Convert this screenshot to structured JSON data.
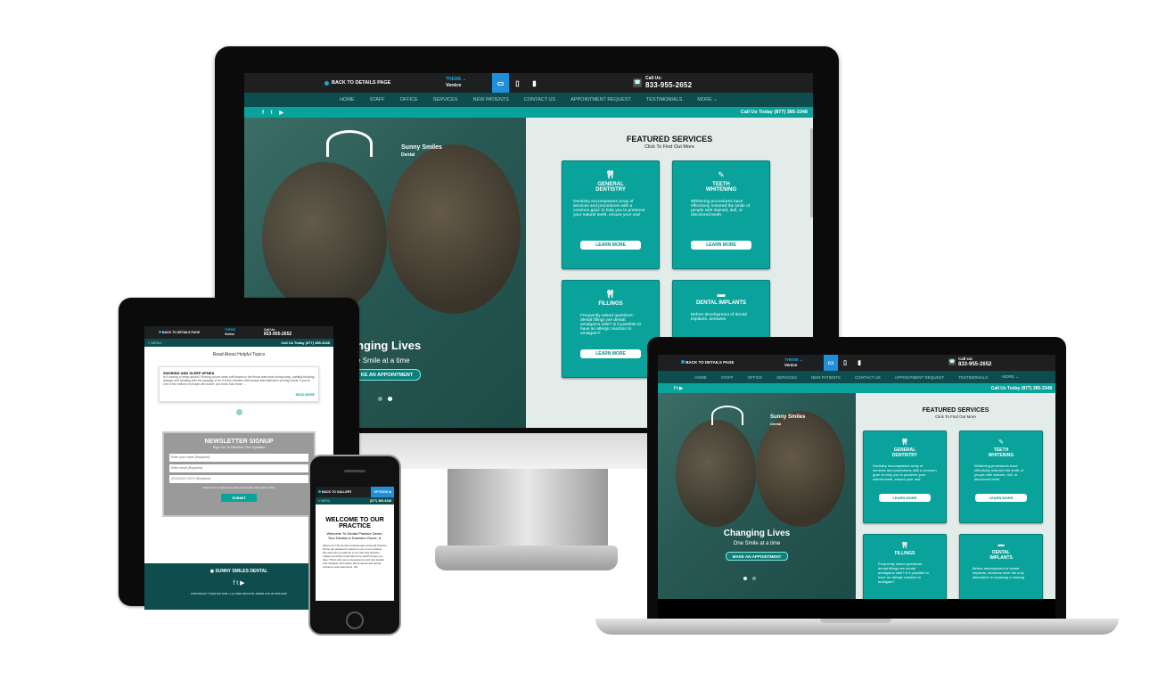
{
  "topbar": {
    "back_label": "BACK TO DETAILS PAGE",
    "theme_label": "THEME",
    "theme_value": "Venice",
    "call_label": "Call Us:",
    "call_number": "833-955-2652"
  },
  "nav": {
    "items": [
      "HOME",
      "STAFF",
      "OFFICE",
      "SERVICES",
      "NEW PATIENTS",
      "CONTACT US",
      "APPOINTMENT REQUEST",
      "TESTIMONIALS",
      "MORE"
    ]
  },
  "social": {
    "icons": "f  t  ▶",
    "call_today": "Call Us Today (877) 385-3348"
  },
  "hero": {
    "brand": "Sunny Smiles",
    "brand_sub": "Dental",
    "title_desktop": "nging Lives",
    "subtitle_desktop": "e Smile at a time",
    "title": "Changing Lives",
    "subtitle": "One Smile at a time",
    "cta": "MAKE AN APPOINTMENT",
    "cta_desktop": "KE AN APPOINTMENT"
  },
  "services": {
    "heading": "FEATURED SERVICES",
    "subheading": "Click To Find Out More",
    "cards": [
      {
        "title": "GENERAL DENTISTRY",
        "desc": "Dentistry encompasses array of services and procedures with a common goal: to help you to preserve your natural teeth, ensure your oral",
        "button": "LEARN MORE"
      },
      {
        "title": "TEETH WHITENING",
        "desc": "Whitening procedures have effectively restored the smile of people with stained, dull, or discolored teeth.",
        "button": "LEARN MORE"
      },
      {
        "title": "FILLINGS",
        "desc": "Frequently asked questions: dental fillings are dental amalgams safe? is it possible to have an allergic reaction to amalgam?",
        "button": "LEARN MORE"
      },
      {
        "title": "DENTAL IMPLANTS",
        "desc": "Before development of dental implants, dentures",
        "desc_laptop": "Before development of dental implants, dentures were the only alternative to replacing a missing",
        "button": "LEARN MORE"
      }
    ]
  },
  "tablet": {
    "menu": "≡ MENU",
    "call": "Call Us Today (877) 385-3348",
    "heading": "Read About Helpful Topics",
    "post_title": "SNORING AND SLEEP APNEA",
    "post_text": "Is it snoring or sleep apnea? Snoring occurs when soft tissues in the throat area relax during sleep, partially blocking airways and vibrating with the passage of air. It's this vibration that causes that distinctive snoring sound. If you're one of the millions of people who snore, you know how those ...",
    "read_more": "READ MORE",
    "newsletter_title": "NEWSLETTER SIGNUP",
    "newsletter_sub": "Sign Up To Receive Our Updates",
    "name_placeholder": "Enter your name (Required)",
    "email_placeholder": "Enter email (Required)",
    "phone_placeholder": "(XXX)XXX-XXXX (Required)",
    "disclaimer": "Please do not submit any Protected Health Information (PHI).",
    "submit": "SUBMIT",
    "footer_brand": "SUNNY SMILES DENTAL",
    "footer_icons": "f  t  ▶",
    "copyright": "COPYRIGHT © 2020 MH SUB I, LLC DBA OFFICITE.   ADMIN LOG IN     SITE MAP"
  },
  "phone": {
    "back": "BACK TO GALLERY",
    "options": "OPTIONS",
    "menu": "≡ MENU",
    "call": "(877) 385-3348",
    "welcome_title": "WELCOME TO OUR PRACTICE",
    "welcome_sub": "Welcome To Dental Practice Demo, Your Dentist in Downers Grove, IL",
    "body": "Welcome! This dental professionals at Dental Practice Demo are pleased to welcome you to our practice. We want all our patients to be informed decision makers and fully understand any health issues you face. That's why we've developed a web site loaded with valuable information about dental and dental problems and treatments. We"
  },
  "colors": {
    "teal": "#0aa39b",
    "dark_teal": "#0e4d4d",
    "topbar": "#1d1f20",
    "accent_blue": "#1e8fd8"
  }
}
